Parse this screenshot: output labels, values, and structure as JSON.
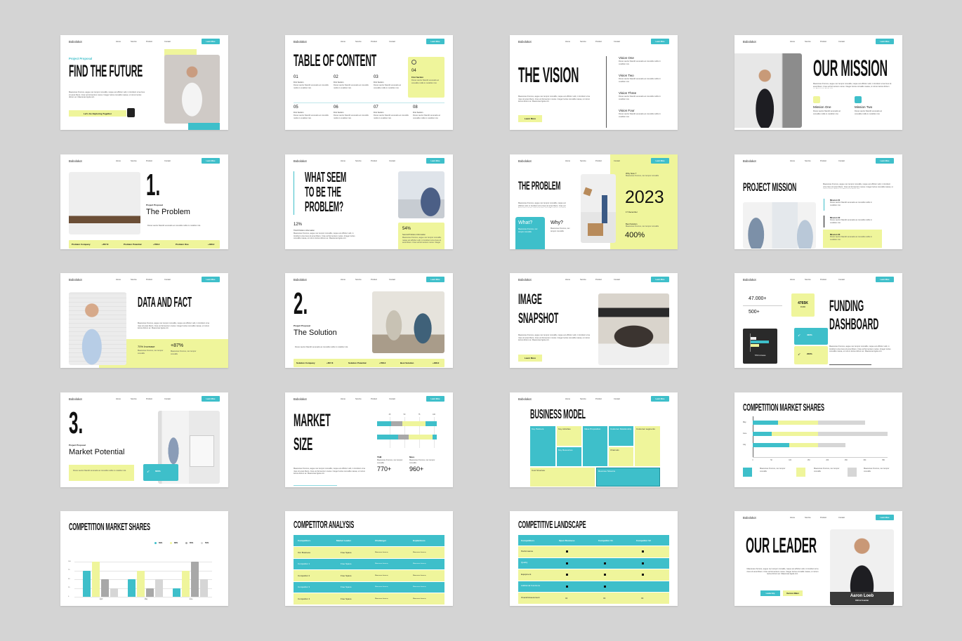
{
  "header": {
    "logo": "Bobolokot",
    "nav": [
      "Home",
      "Service",
      "Product",
      "Contact"
    ],
    "cta": "Learn More"
  },
  "colors": {
    "teal": "#3ebfca",
    "yellow": "#eff59b",
    "background": "#d4d4d4",
    "dark": "#222222",
    "gray": "#a8a8a8",
    "light_gray": "#d6d6d6"
  },
  "lorem": {
    "p": "Maecenas rhoncus, augue nec tempor convallis, neque est efficitur velit, in tincidunt urna risus sit amet libero. Cras vel fermentum metus. Integer luctus convallis massa, ut rutrum lectus dictum ac. Maecenas ligula orci.",
    "s": "Donec auctor blandit venenatis ac convallis mollis in curabitur nisi.",
    "xs": "Maecenas rhoncus, nec tempor convallis"
  },
  "slides": [
    {
      "tag": "Project Proposal",
      "title": "FIND THE FUTURE",
      "button": "Let's Go Exploring Together",
      "icon": "fingerprint-icon"
    },
    {
      "title": "TABLE OF CONTENT",
      "items": [
        {
          "num": "01",
          "label": "First Section"
        },
        {
          "num": "02",
          "label": "First Section"
        },
        {
          "num": "03",
          "label": "First Section"
        },
        {
          "num": "04",
          "label": "First Section"
        },
        {
          "num": "05",
          "label": "First Section"
        },
        {
          "num": "06",
          "label": "First Section"
        },
        {
          "num": "07",
          "label": "First Section"
        },
        {
          "num": "08",
          "label": "First Section"
        }
      ],
      "icon": "globe-icon"
    },
    {
      "title": "THE VISION",
      "button": "Learn More",
      "items": [
        "Vision One",
        "Vision Two",
        "Vision Three",
        "Vision Four"
      ]
    },
    {
      "title": "OUR MISSION",
      "items": [
        "Mission One",
        "Mission Two"
      ]
    },
    {
      "number": "1.",
      "tag": "Project Proposal",
      "title": "The Problem",
      "stats": [
        {
          "label": "Problem Company",
          "value": "+657.8"
        },
        {
          "label": "Problem Potential",
          "value": "+768.2"
        },
        {
          "label": "Problem One",
          "value": "+468.2"
        }
      ]
    },
    {
      "title_lines": [
        "WHAT SEEM",
        "TO BE THE",
        "PROBLEM?"
      ],
      "stat1": {
        "value": "12%",
        "label": "Third Problem Information"
      },
      "stat2": {
        "value": "54%",
        "label": "Second Problem Information"
      }
    },
    {
      "title": "THE PROBLEM",
      "what": "What?",
      "why": "Why?",
      "why_now": "Why Now ?",
      "year": "2023",
      "date": "17 December",
      "best": "Best Solution",
      "percent": "400%"
    },
    {
      "title": "PROJECT MISSION",
      "items": [
        "Mission 01",
        "Mission 02",
        "Mission 03"
      ]
    },
    {
      "title": "DATA AND FACT",
      "stat1": "70% Increase",
      "stat2": "+87%"
    },
    {
      "number": "2.",
      "tag": "Project Proposal",
      "title": "The Solution",
      "stats": [
        {
          "label": "Solution Company",
          "value": "+657.8"
        },
        {
          "label": "Solution Potential",
          "value": "+768.2"
        },
        {
          "label": "Best Solution",
          "value": "+468.2"
        }
      ]
    },
    {
      "title_lines": [
        "IMAGE",
        "SNAPSHOT"
      ],
      "button": "Learn More"
    },
    {
      "stat_a": "47.000+",
      "stat_b": "500+",
      "fund_value": "4765K",
      "fund_label": "FUND",
      "chart_caption": "70% Increase",
      "card1": "400%",
      "card2": "200%",
      "title_lines": [
        "FUNDING",
        "DASHBOARD"
      ]
    },
    {
      "number": "3.",
      "tag": "Project Proposal",
      "title": "Market Potential",
      "badge": "600%"
    },
    {
      "title_lines": [
        "MARKET",
        "SIZE"
      ],
      "ticks": [
        "25",
        "50",
        "75",
        "100"
      ],
      "bars": [
        [
          23,
          19,
          39,
          19
        ],
        [
          35,
          18,
          40,
          7
        ]
      ],
      "bar_colors": [
        "teal",
        "gray",
        "yellow",
        "teal"
      ],
      "tam": {
        "label": "TAM",
        "value": "770+"
      },
      "more": {
        "label": "More",
        "value": "960+"
      }
    },
    {
      "title": "BUSINESS MODEL",
      "blocks": [
        {
          "label": "Key Partners",
          "color": "teal"
        },
        {
          "label": "Key Activities",
          "color": "yellow"
        },
        {
          "label": "Key Resources",
          "color": "teal"
        },
        {
          "label": "Value Proposition",
          "color": "teal"
        },
        {
          "label": "Customer Relationship",
          "color": "teal"
        },
        {
          "label": "Channels",
          "color": "yellow"
        },
        {
          "label": "Customer segments",
          "color": "yellow"
        },
        {
          "label": "Cost Structure",
          "color": "yellow"
        },
        {
          "label": "Revenue Streams",
          "color": "teal"
        }
      ]
    },
    {
      "title": "COMPETITION MARKET SHARES"
    },
    {
      "title": "COMPETITION MARKET SHARES"
    },
    {
      "title": "COMPETITOR ANALYSIS",
      "columns": [
        "Competitors",
        "Market Leader",
        "Challenger",
        "Explantions"
      ],
      "rows": [
        [
          "Our Business",
          "Free Space"
        ],
        [
          "Competitor 1",
          "Free Space"
        ],
        [
          "Competitor 2",
          "Free Space"
        ],
        [
          "Competitor 3",
          "Free Space"
        ],
        [
          "Competitor 4",
          "Free Space"
        ]
      ]
    },
    {
      "title": "COMPETITIVE LANDSCAPE",
      "columns": [
        "Competitiors",
        "Open Business",
        "Competitor 01",
        "Competitor 02"
      ],
      "rows": [
        {
          "label": "Performance",
          "marks": [
            true,
            false,
            true
          ]
        },
        {
          "label": "Quality",
          "marks": [
            true,
            true,
            true
          ]
        },
        {
          "label": "Equipment",
          "marks": [
            true,
            true,
            true
          ]
        },
        {
          "label": "Additional Functions",
          "marks": [
            true,
            true,
            false
          ]
        },
        {
          "label": "Overall Assessment",
          "values": [
            "04",
            "03",
            "03"
          ]
        }
      ]
    },
    {
      "title": "OUR LEADER",
      "buttons": [
        "Leadership",
        "Decision Maker"
      ],
      "name": "Aaron Loeb",
      "role": "CEO & Founder"
    }
  ],
  "chart_data": [
    {
      "type": "bar",
      "orientation": "horizontal",
      "stacked": true,
      "title": "COMPETITION MARKET SHARES",
      "categories": [
        "May",
        "June",
        "July"
      ],
      "series": [
        {
          "color": "#3ebfca",
          "values": [
            67,
            51,
            97
          ]
        },
        {
          "color": "#eff59b",
          "values": [
            108,
            124,
            78
          ]
        },
        {
          "color": "#d6d6d6",
          "values": [
            126,
            186,
            73
          ]
        }
      ],
      "xticks": [
        "0",
        "50",
        "100",
        "150",
        "200",
        "250",
        "300",
        "350"
      ],
      "xlim": [
        0,
        360
      ],
      "grid": false
    },
    {
      "type": "bar",
      "title": "COMPETITION MARKET SHARES",
      "categories": [
        "April",
        "May",
        "June"
      ],
      "yticks": [
        "0",
        "25",
        "50",
        "75",
        "100"
      ],
      "ylim": [
        0,
        100
      ],
      "grid": true,
      "legend": "top-right",
      "series": [
        {
          "name": "69%",
          "color": "#3ebfca",
          "values": [
            75,
            50,
            25
          ]
        },
        {
          "name": "88%",
          "color": "#eff59b",
          "values": [
            100,
            75,
            75
          ]
        },
        {
          "name": "65%",
          "color": "#a8a8a8",
          "values": [
            50,
            25,
            100
          ]
        },
        {
          "name": "50%",
          "color": "#d6d6d6",
          "values": [
            25,
            50,
            50
          ]
        }
      ]
    }
  ]
}
